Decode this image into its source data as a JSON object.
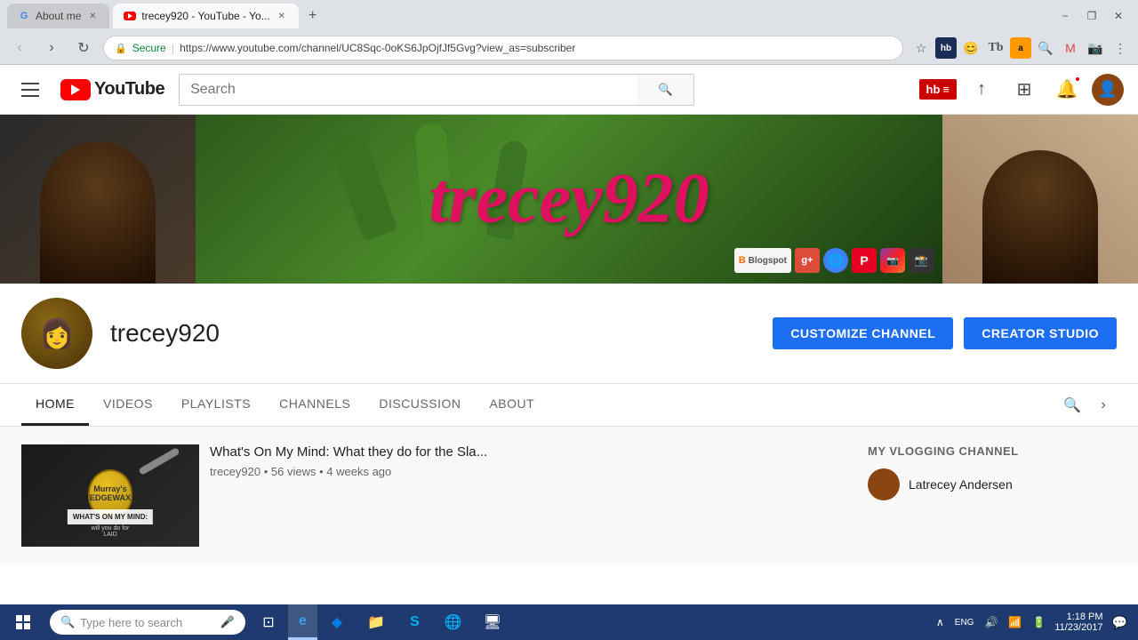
{
  "browser": {
    "tabs": [
      {
        "label": "About me",
        "favicon": "G",
        "active": false,
        "id": "tab-about"
      },
      {
        "label": "trecey920 - YouTube - Yo...",
        "favicon": "▶",
        "active": true,
        "id": "tab-youtube"
      }
    ],
    "url": "https://www.youtube.com/channel/UC8Sqc-0oKS6JpOjfJf5Gvg?view_as=subscriber",
    "secure_label": "Secure",
    "window_controls": [
      "−",
      "❐",
      "✕"
    ]
  },
  "youtube": {
    "search_placeholder": "Search",
    "nav_items": [
      "HOME",
      "VIDEOS",
      "PLAYLISTS",
      "CHANNELS",
      "DISCUSSION",
      "ABOUT"
    ],
    "active_nav": "HOME",
    "channel_name": "trecey920",
    "banner_text": "trecey920",
    "btn_customize": "CUSTOMIZE CHANNEL",
    "btn_creator": "CREATOR STUDIO",
    "video": {
      "title": "What's On My Mind: What they do for the Sla...",
      "channel": "trecey920",
      "views": "56 views",
      "time_ago": "4 weeks ago"
    },
    "sidebar": {
      "label": "MY VLOGGING CHANNEL",
      "channel_name": "Latrecey Andersen"
    }
  },
  "taskbar": {
    "search_text": "Type here to search",
    "time": "1:18 PM",
    "date": "11/23/2017",
    "apps": [
      {
        "name": "Cortana",
        "icon": "🔍"
      },
      {
        "name": "Edge",
        "icon": "e",
        "active": true
      },
      {
        "name": "Dropbox",
        "icon": "◆"
      },
      {
        "name": "Files",
        "icon": "📁"
      },
      {
        "name": "Skype",
        "icon": "S"
      },
      {
        "name": "Chrome",
        "icon": "●"
      }
    ]
  },
  "social_icons": [
    {
      "name": "Blogspot",
      "color": "#ff6600",
      "label": "B"
    },
    {
      "name": "Google+",
      "color": "#dd4b39",
      "label": "G+"
    },
    {
      "name": "Globe",
      "color": "#3b82f6",
      "label": "🌐"
    },
    {
      "name": "Pinterest",
      "color": "#e60023",
      "label": "P"
    },
    {
      "name": "Instagram",
      "color": "#833ab4",
      "label": "📷"
    },
    {
      "name": "Camera",
      "color": "#555",
      "label": "📸"
    }
  ]
}
